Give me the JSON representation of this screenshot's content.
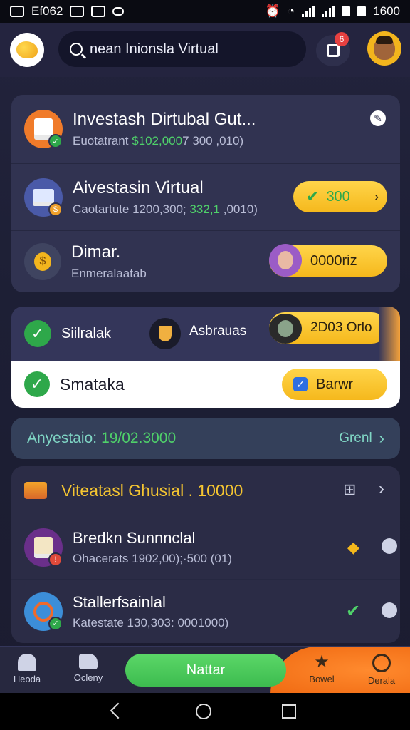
{
  "status": {
    "left_text": "Ef062",
    "right_text": "1600"
  },
  "header": {
    "search_text": "nean Inionsla Virtual",
    "badge": "6"
  },
  "investments": [
    {
      "title": "Investash Dirtubal Gut...",
      "sub_prefix": "Euotatrant",
      "sub_value": "$102,000",
      "sub_suffix": "7 300 ,010)"
    },
    {
      "title": "Aivestasin Virtual",
      "sub_prefix": "Caotartute 1200,300; ",
      "sub_value": "332,1",
      "sub_suffix": " ,0010)",
      "pill": "300"
    },
    {
      "title": "Dimar.",
      "sub": "Enmeralaatab",
      "pill": "0000riz"
    }
  ],
  "tasks": {
    "row1": {
      "left": "Siilralak",
      "mid": "Asbrauas",
      "pill": "2D03 Orlo"
    },
    "row2": {
      "label": "Smataka",
      "pill": "Barwr"
    }
  },
  "summary": {
    "label": "Anyestaio: ",
    "value": "19/02.3000",
    "link": "Grenl"
  },
  "list": {
    "heading": "Viteatasl Ghusial . 10000",
    "items": [
      {
        "title": "Bredkn Sunnnclal",
        "sub": "Ohacerats 1902,00);·500 (01)"
      },
      {
        "title": "Stallerfsainlal",
        "sub": "Katestate 130,303: 0001000)"
      }
    ]
  },
  "nav": {
    "home": "Heoda",
    "item2": "Ocleny",
    "cta": "Nattar",
    "item4": "Bowel",
    "item5": "Derala"
  }
}
